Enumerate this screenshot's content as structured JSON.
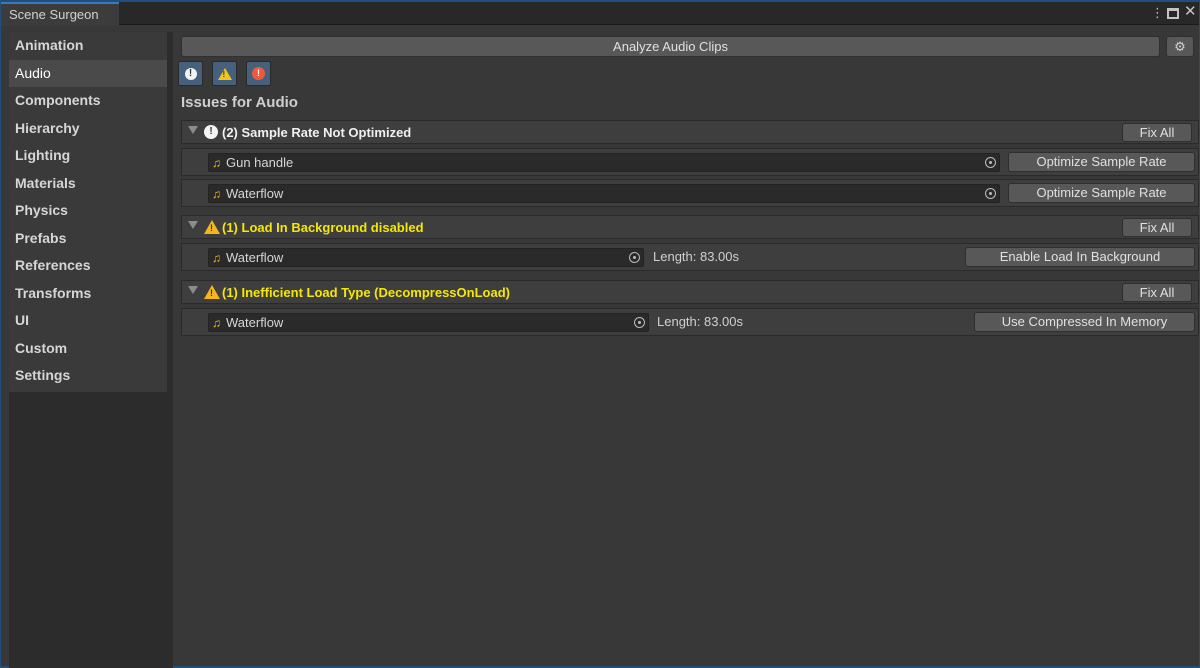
{
  "window": {
    "tab_title": "Scene Surgeon",
    "menu_glyph": "⋮",
    "close_glyph": "✕"
  },
  "sidebar": {
    "items": [
      {
        "label": "Animation"
      },
      {
        "label": "Audio",
        "active": true
      },
      {
        "label": "Components"
      },
      {
        "label": "Hierarchy"
      },
      {
        "label": "Lighting"
      },
      {
        "label": "Materials"
      },
      {
        "label": "Physics"
      },
      {
        "label": "Prefabs"
      },
      {
        "label": "References"
      },
      {
        "label": "Transforms"
      },
      {
        "label": "UI"
      },
      {
        "label": "Custom"
      },
      {
        "label": "Settings"
      }
    ]
  },
  "toolbar": {
    "analyze_label": "Analyze Audio Clips",
    "gear_glyph": "⚙"
  },
  "filters": {
    "info_glyph": "!",
    "warn_glyph": "!",
    "error_glyph": "!"
  },
  "issues_title": "Issues for Audio",
  "groups": [
    {
      "severity": "info",
      "title": "(2) Sample Rate Not Optimized",
      "fix_all": "Fix All",
      "rows": [
        {
          "asset": "Gun handle",
          "action": "Optimize Sample Rate"
        },
        {
          "asset": "Waterflow",
          "action": "Optimize Sample Rate"
        }
      ]
    },
    {
      "severity": "warning",
      "title": "(1) Load In Background disabled",
      "fix_all": "Fix All",
      "rows": [
        {
          "asset": "Waterflow",
          "length": "Length: 83.00s",
          "action": "Enable Load In Background"
        }
      ]
    },
    {
      "severity": "warning",
      "title": "(1) Inefficient Load Type (DecompressOnLoad)",
      "fix_all": "Fix All",
      "rows": [
        {
          "asset": "Waterflow",
          "length": "Length: 83.00s",
          "action": "Use Compressed In Memory"
        }
      ]
    }
  ],
  "icons": {
    "note_glyph": "♫",
    "info_glyph": "!",
    "warn_glyph": "!"
  },
  "colors": {
    "accent": "#3a79bb",
    "warning_text": "#f5e800",
    "warning_icon": "#f5b61a",
    "error_icon": "#ef5a3d",
    "panel": "#383838"
  }
}
